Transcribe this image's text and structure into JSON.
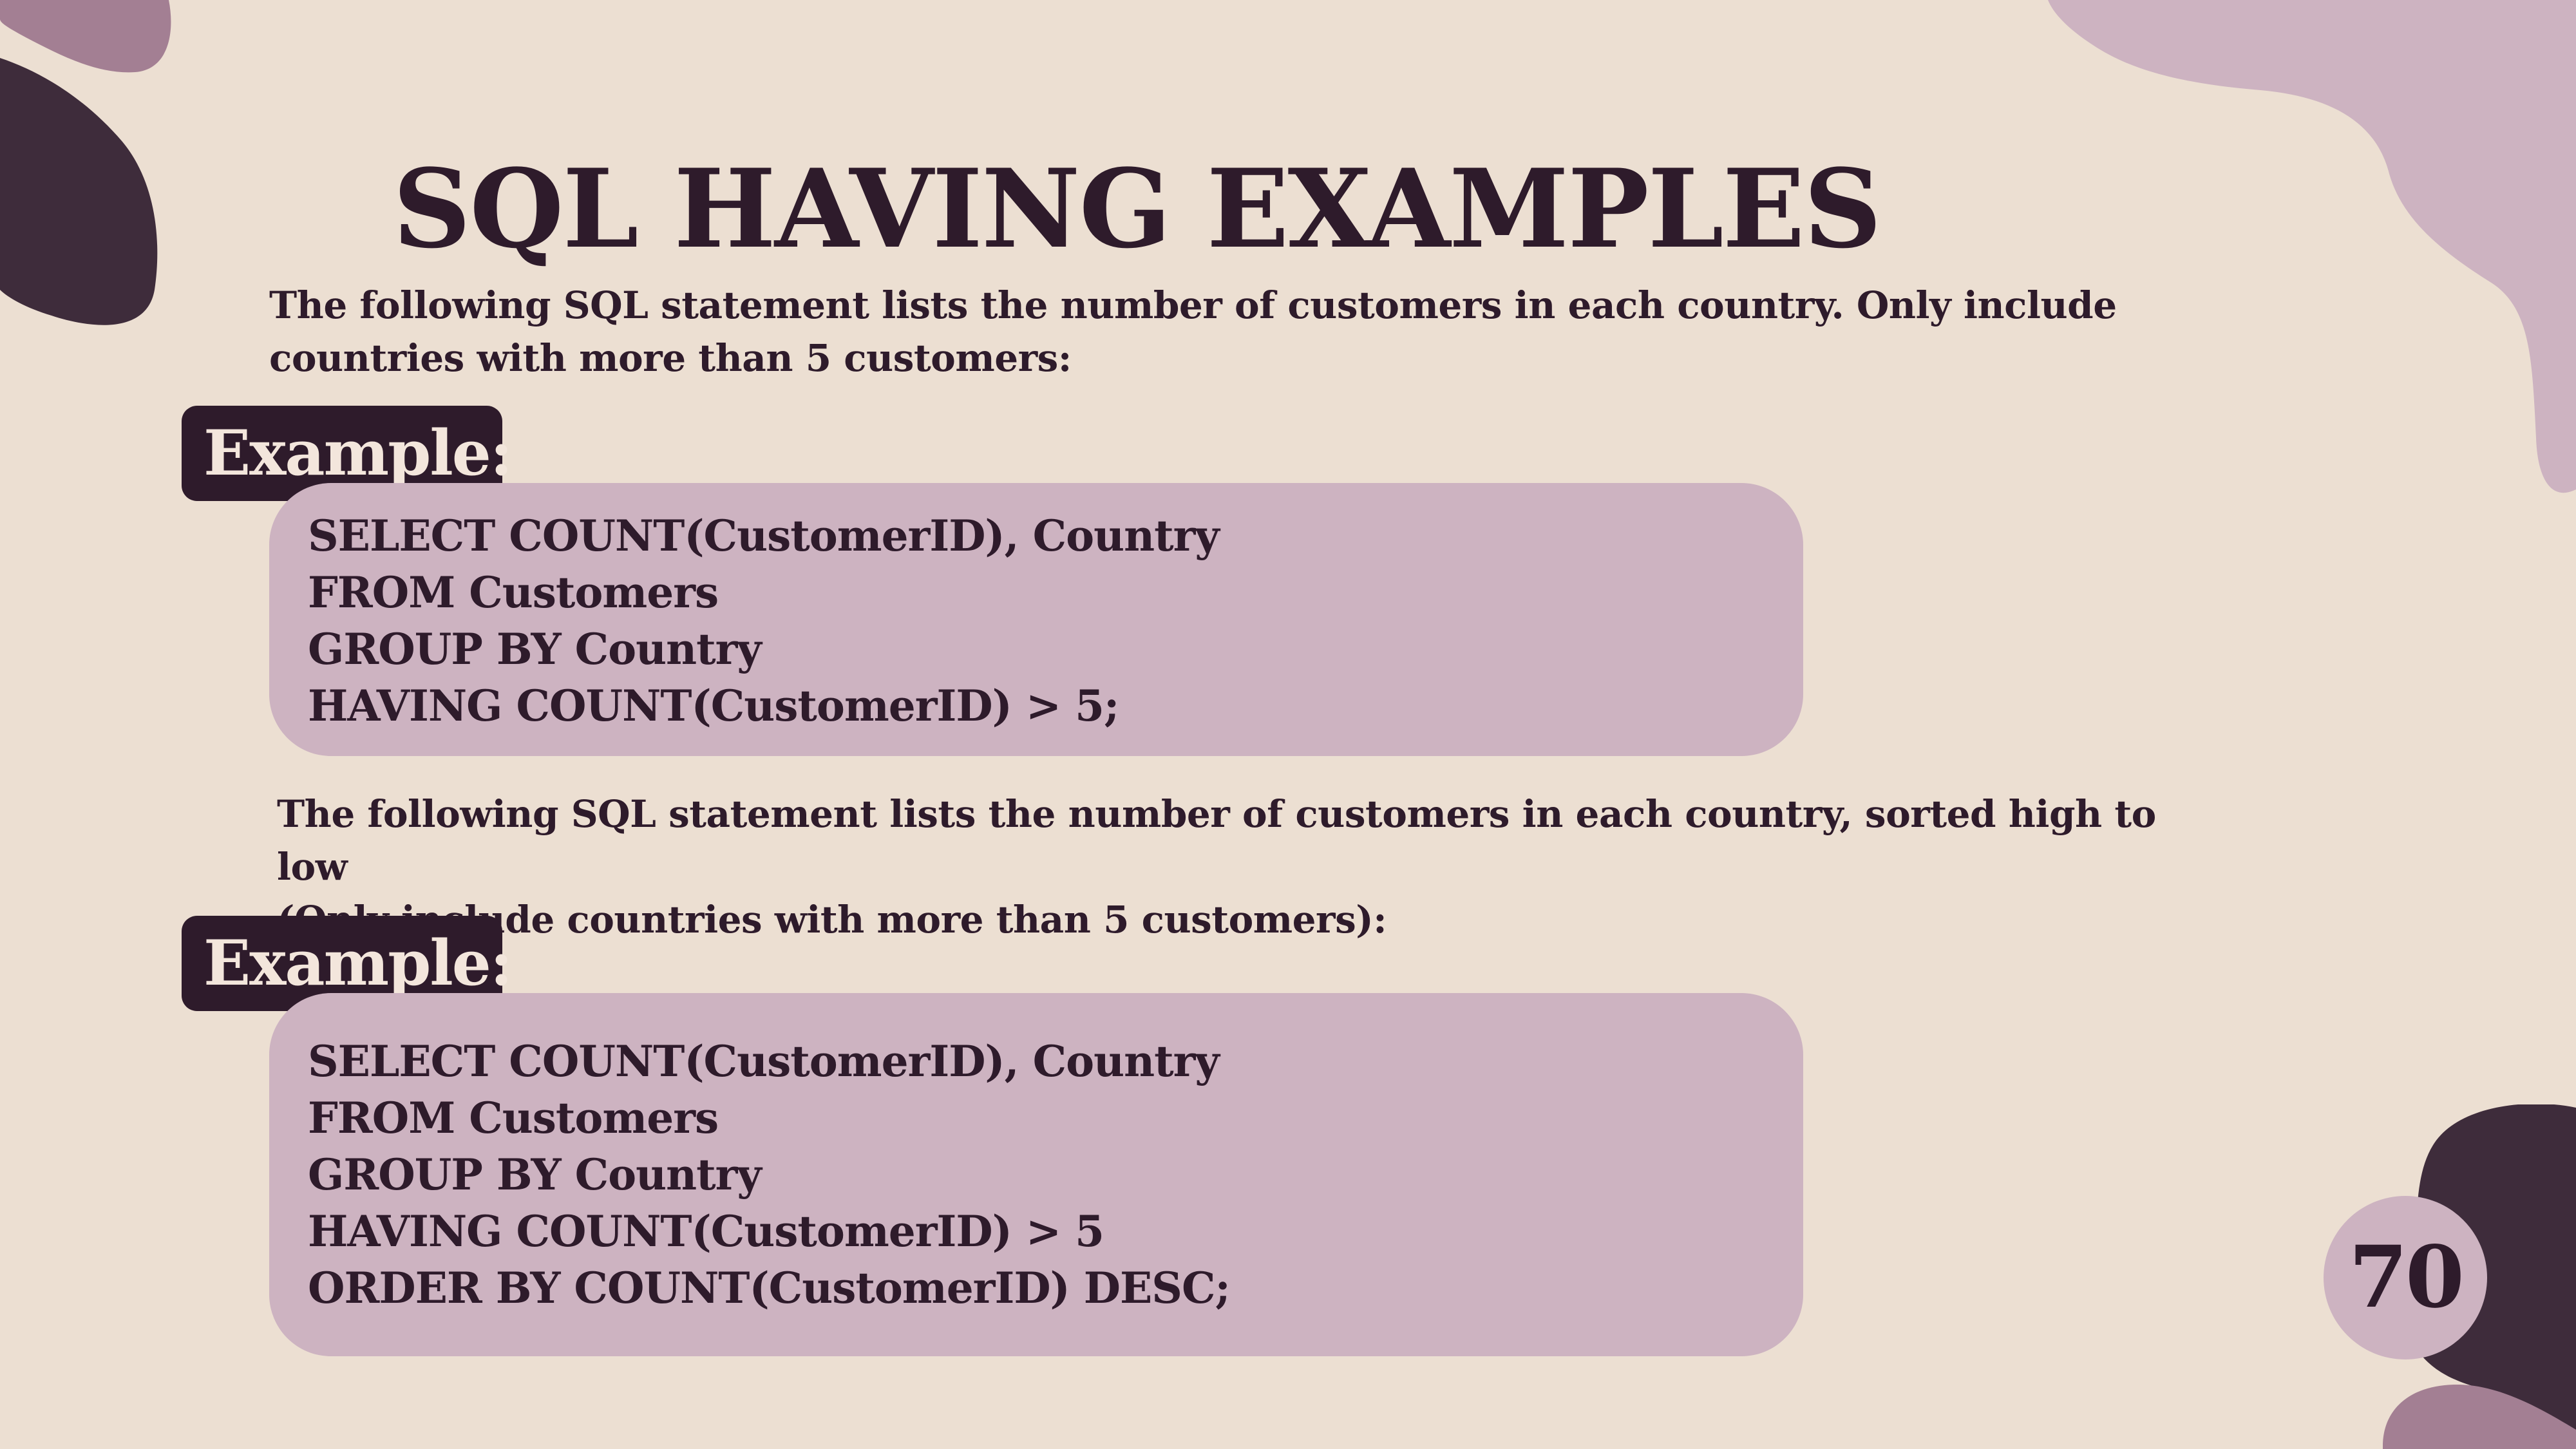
{
  "slide": {
    "title": "SQL HAVING EXAMPLES",
    "page_number": "70",
    "colors": {
      "background": "#ecdfd2",
      "dark": "#2e1b2b",
      "code_background": "#cdb3c1",
      "accent_mauve": "#a37f93"
    }
  },
  "example_1": {
    "description_lines": [
      "The following SQL statement lists the number of customers in each country. Only include",
      "countries with more than 5 customers:"
    ],
    "tag": "Example:",
    "code": [
      "SELECT COUNT(CustomerID), Country",
      "FROM Customers",
      "GROUP BY Country",
      "HAVING COUNT(CustomerID) > 5;"
    ]
  },
  "example_2": {
    "description_lines": [
      "The following SQL statement lists the number of customers in each country, sorted high to low",
      "(Only include countries with more than 5 customers):"
    ],
    "tag": "Example:",
    "code": [
      "SELECT COUNT(CustomerID), Country",
      "FROM Customers",
      "GROUP BY Country",
      "HAVING COUNT(CustomerID) > 5",
      "ORDER BY COUNT(CustomerID) DESC;"
    ]
  }
}
